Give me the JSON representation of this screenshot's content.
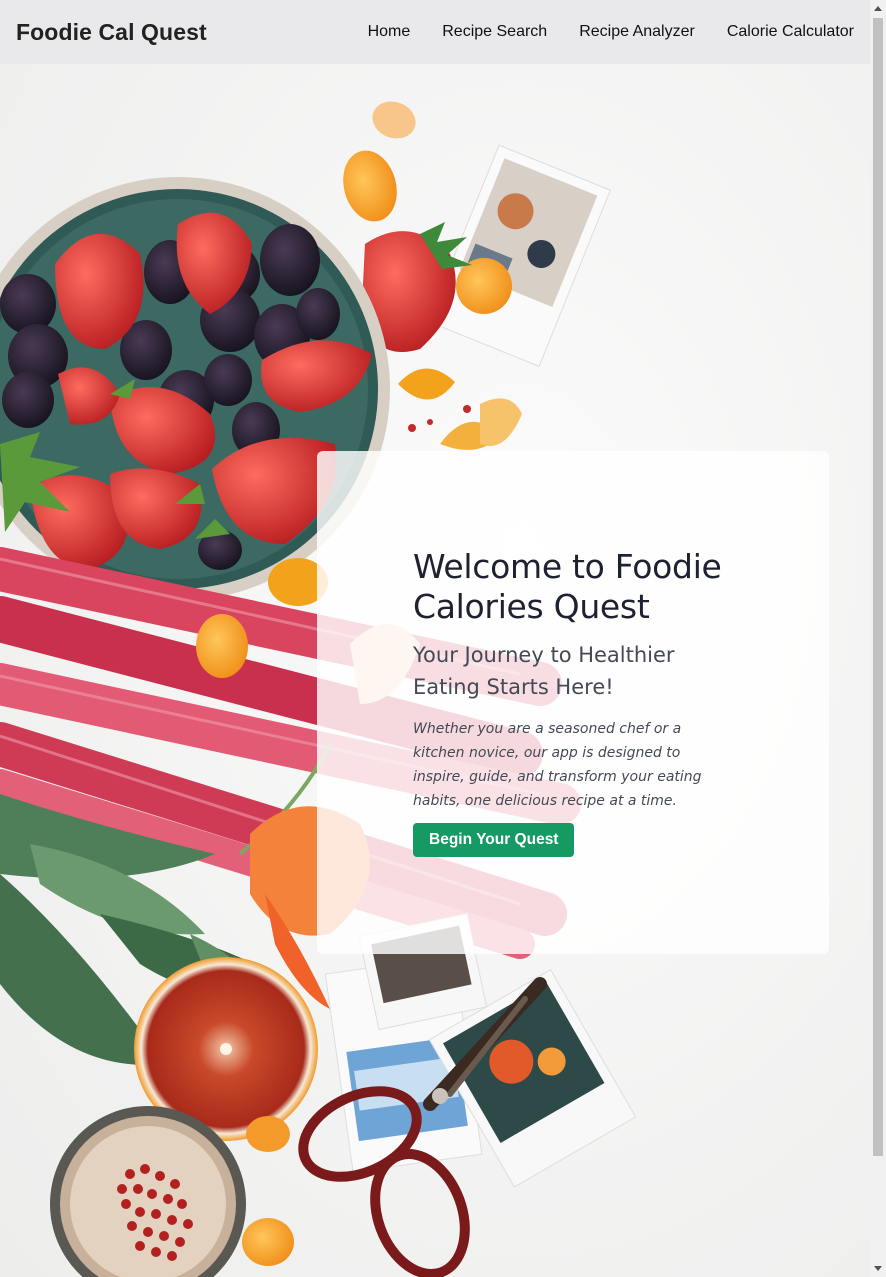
{
  "brand": "Foodie Cal Quest",
  "nav": {
    "items": [
      "Home",
      "Recipe Search",
      "Recipe Analyzer",
      "Calorie Calculator"
    ]
  },
  "hero": {
    "title": "Welcome to Foodie Calories Quest",
    "subtitle": "Your Journey to Healthier Eating Starts Here!",
    "description": "Whether you are a seasoned chef or a kitchen novice, our app is designed to inspire, guide, and transform your eating habits, one delicious recipe at a time.",
    "cta_label": "Begin Your Quest"
  },
  "colors": {
    "navbar_bg": "#e9e9eb",
    "cta_green": "#159a63",
    "strawberry_red": "#d93a3a",
    "rhubarb_pink": "#d9455f",
    "orange": "#f5a623"
  }
}
